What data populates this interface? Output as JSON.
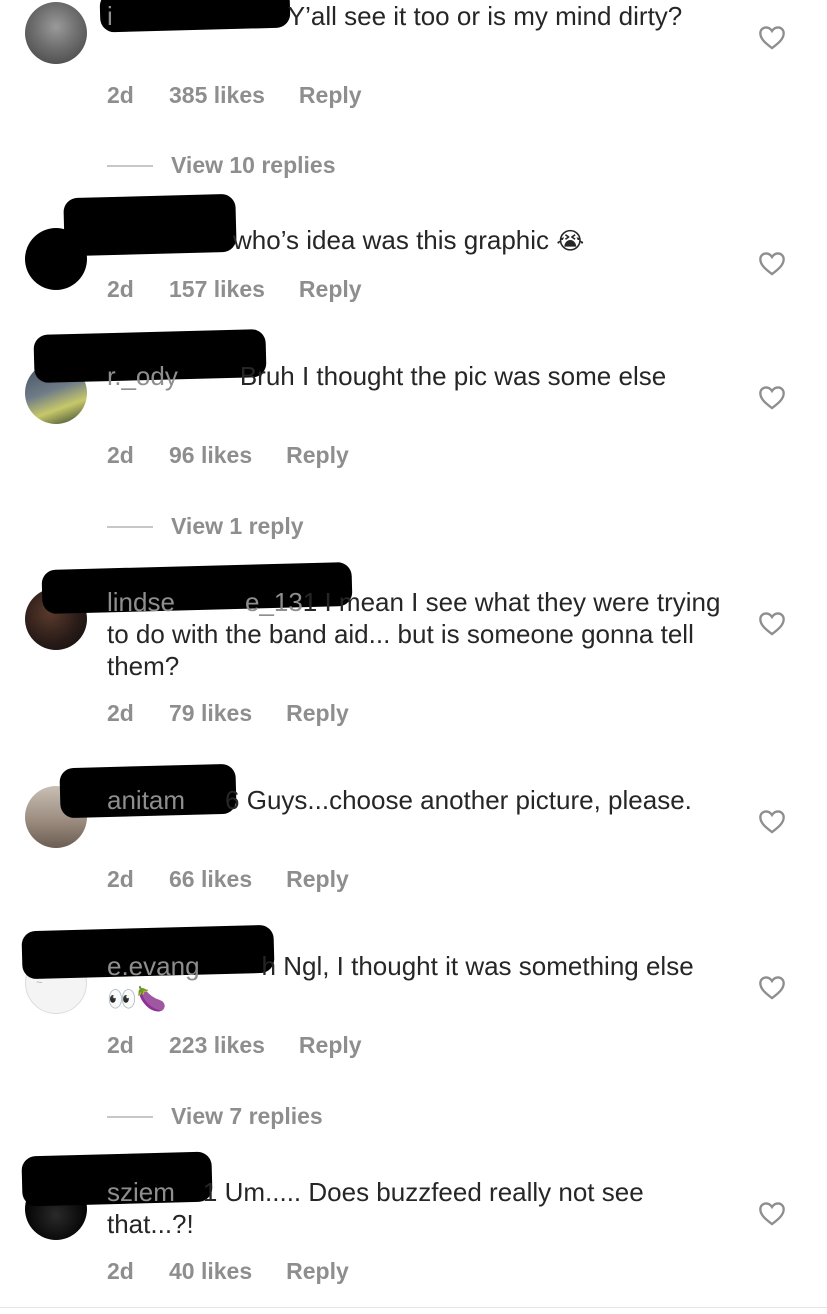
{
  "comments": [
    {
      "username": "i",
      "text": "Y’all see it too or is my mind dirty?",
      "time": "2d",
      "likes": "385 likes",
      "reply": "Reply",
      "replies": "View 10 replies"
    },
    {
      "username": "",
      "text": "who’s idea was this graphic",
      "emoji": "😭",
      "time": "2d",
      "likes": "157 likes",
      "reply": "Reply"
    },
    {
      "username": "r._ody",
      "text": "Bruh I thought the pic was some else",
      "time": "2d",
      "likes": "96 likes",
      "reply": "Reply",
      "replies": "View 1 reply"
    },
    {
      "username": "lindse",
      "username_tail": "e_13",
      "text": "1 I mean I see what they were trying to do with the band aid... but is someone gonna tell them?",
      "time": "2d",
      "likes": "79 likes",
      "reply": "Reply"
    },
    {
      "username": "anitam",
      "text": "6 Guys...choose another picture, please.",
      "time": "2d",
      "likes": "66 likes",
      "reply": "Reply"
    },
    {
      "username": "e.evang",
      "text": "h Ngl, I thought it was something else",
      "emoji": "👀🍆",
      "time": "2d",
      "likes": "223 likes",
      "reply": "Reply",
      "replies": "View 7 replies"
    },
    {
      "username": "sziem",
      "text": "1 Um..... Does buzzfeed really not see that...?!",
      "time": "2d",
      "likes": "40 likes",
      "reply": "Reply"
    }
  ],
  "icons": {
    "like": "heart-outline-icon"
  },
  "colors": {
    "text": "#262626",
    "muted": "#8e8e8e",
    "divider": "#c7c7c7"
  }
}
